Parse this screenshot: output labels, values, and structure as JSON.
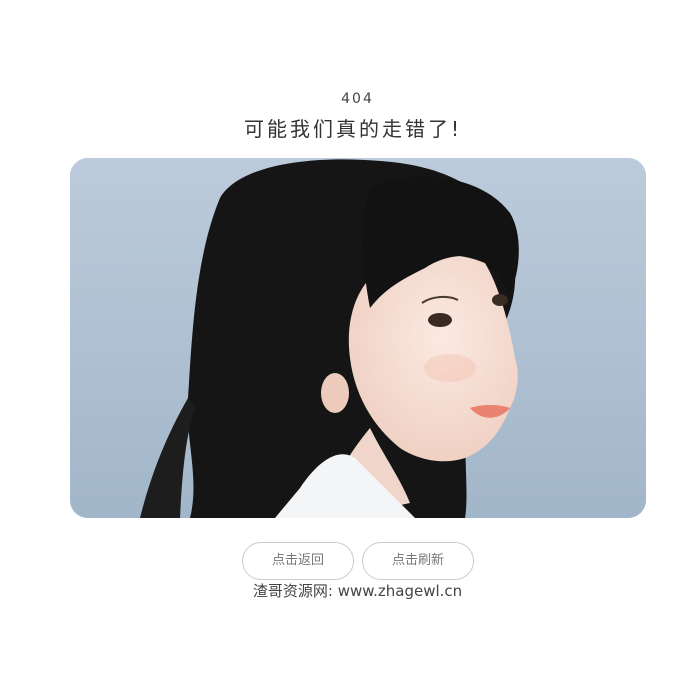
{
  "error": {
    "code": "404",
    "message": "可能我们真的走错了!"
  },
  "actions": {
    "back_label": "点击返回",
    "refresh_label": "点击刷新"
  },
  "footer": {
    "site_name": "渣哥资源网",
    "separator": ":",
    "site_url": "www.zhagewl.cn"
  },
  "colors": {
    "sky": "#b3c4d6",
    "hair": "#141414",
    "skin": "#f3ddd2",
    "button_border": "#cccccc",
    "text": "#333333"
  }
}
